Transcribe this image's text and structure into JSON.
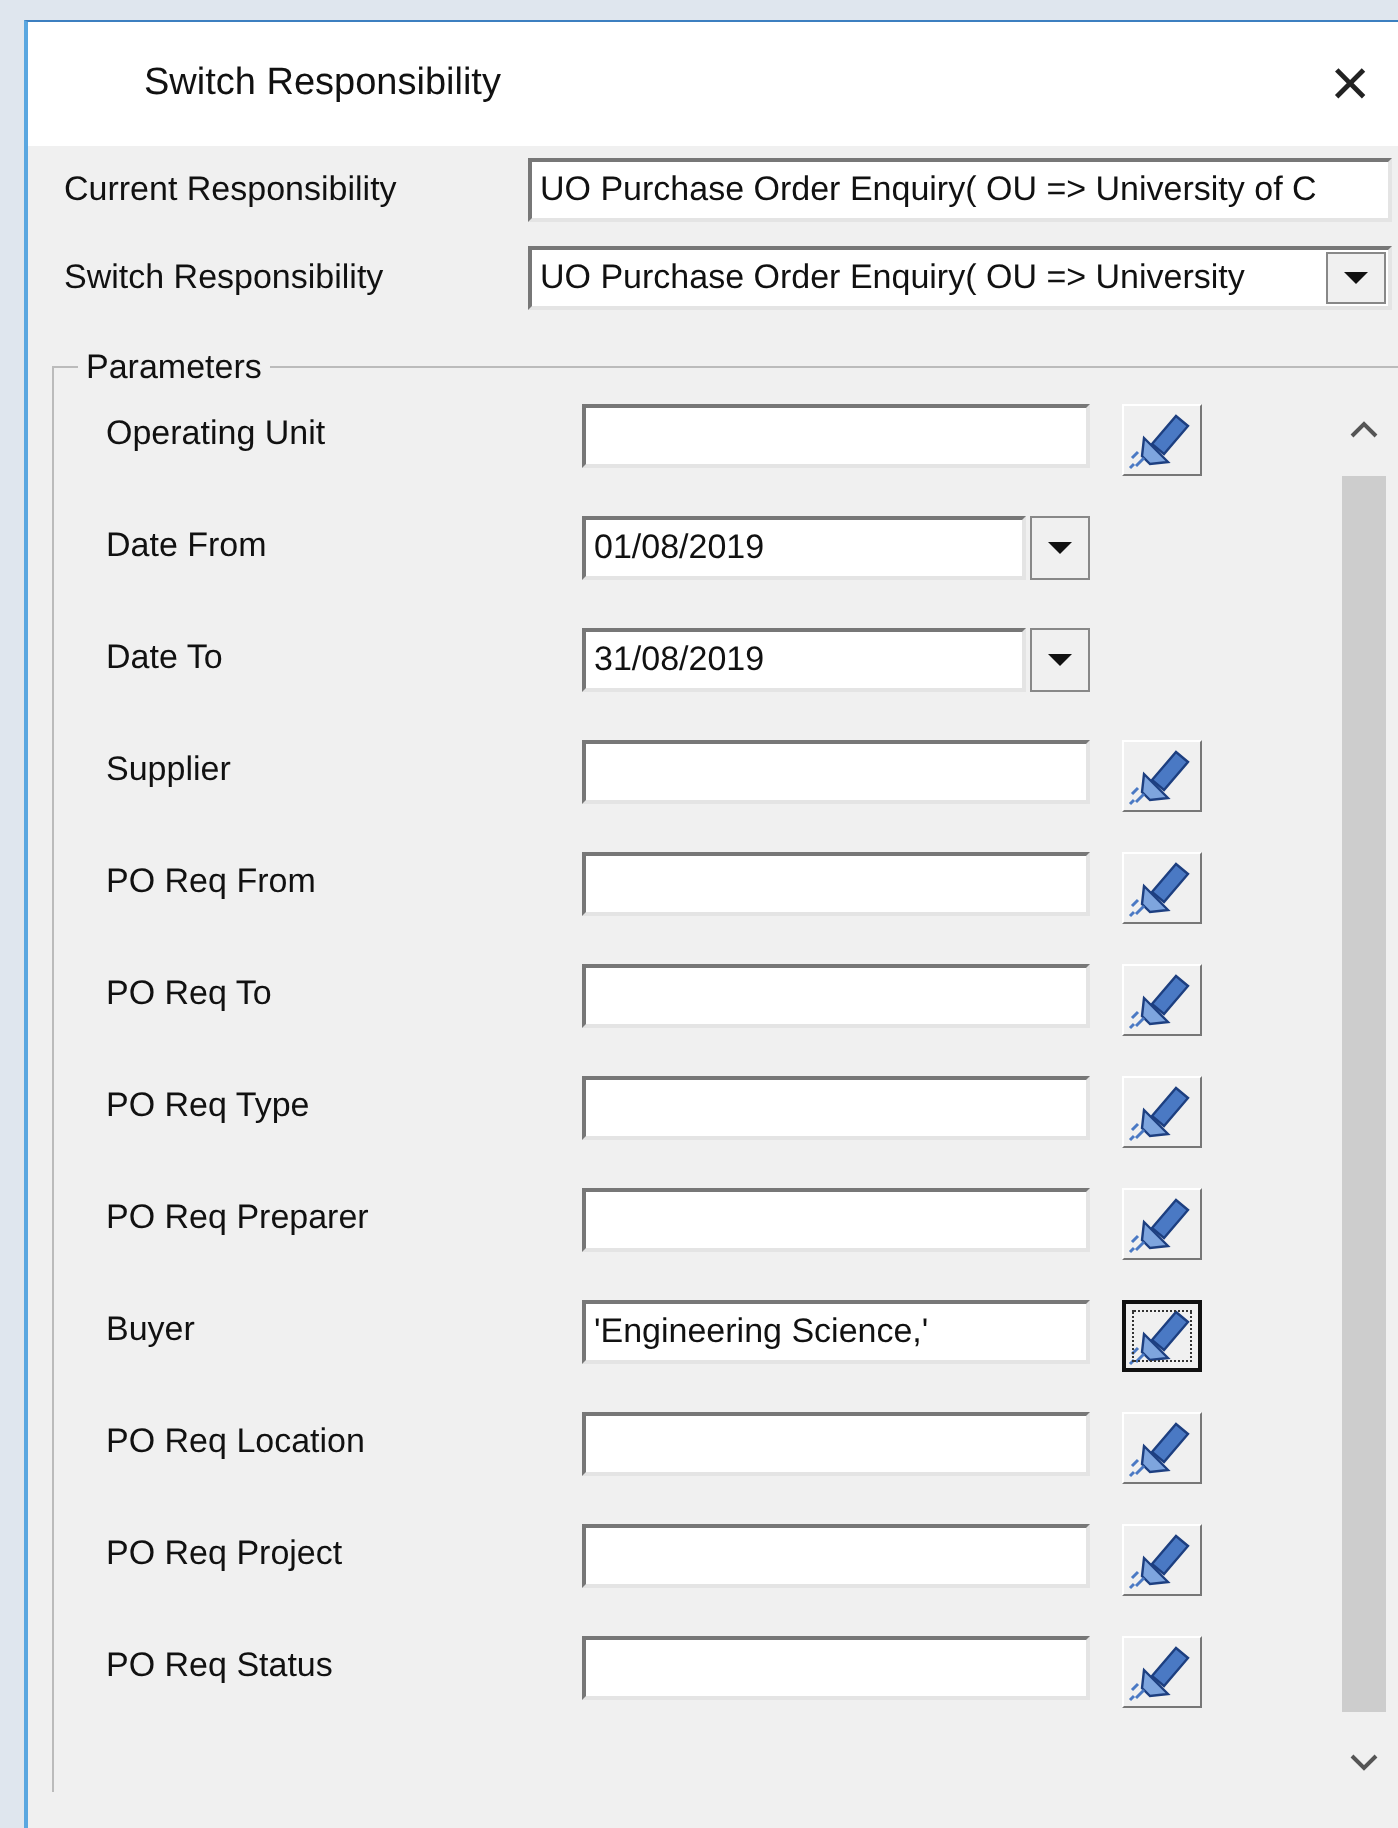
{
  "window": {
    "title": "Switch Responsibility",
    "close": "×"
  },
  "responsibility": [
    {
      "kind": "text",
      "label": "Current Responsibility",
      "value": "UO Purchase Order Enquiry( OU => University of C"
    },
    {
      "kind": "dropdown",
      "label": "Switch Responsibility",
      "value": "UO Purchase Order Enquiry( OU => University"
    }
  ],
  "parameters": {
    "legend": "Parameters",
    "fields": [
      {
        "kind": "lov",
        "label": "Operating Unit",
        "focused": false
      },
      {
        "kind": "date",
        "label": "Date From",
        "value": "01/08/2019"
      },
      {
        "kind": "date",
        "label": "Date To",
        "value": "31/08/2019"
      },
      {
        "kind": "lov",
        "label": "Supplier",
        "focused": false
      },
      {
        "kind": "lov",
        "label": "PO Req From",
        "focused": false
      },
      {
        "kind": "lov",
        "label": "PO Req To",
        "focused": false
      },
      {
        "kind": "lov",
        "label": "PO Req Type",
        "focused": false
      },
      {
        "kind": "lov",
        "label": "PO Req Preparer",
        "focused": false
      },
      {
        "kind": "lov",
        "label": "Buyer",
        "value": "'Engineering Science,'",
        "focused": true
      },
      {
        "kind": "lov",
        "label": "PO Req Location",
        "focused": false
      },
      {
        "kind": "lov",
        "label": "PO Req Project",
        "focused": false
      },
      {
        "kind": "lov",
        "label": "PO Req Status",
        "focused": false
      }
    ]
  }
}
